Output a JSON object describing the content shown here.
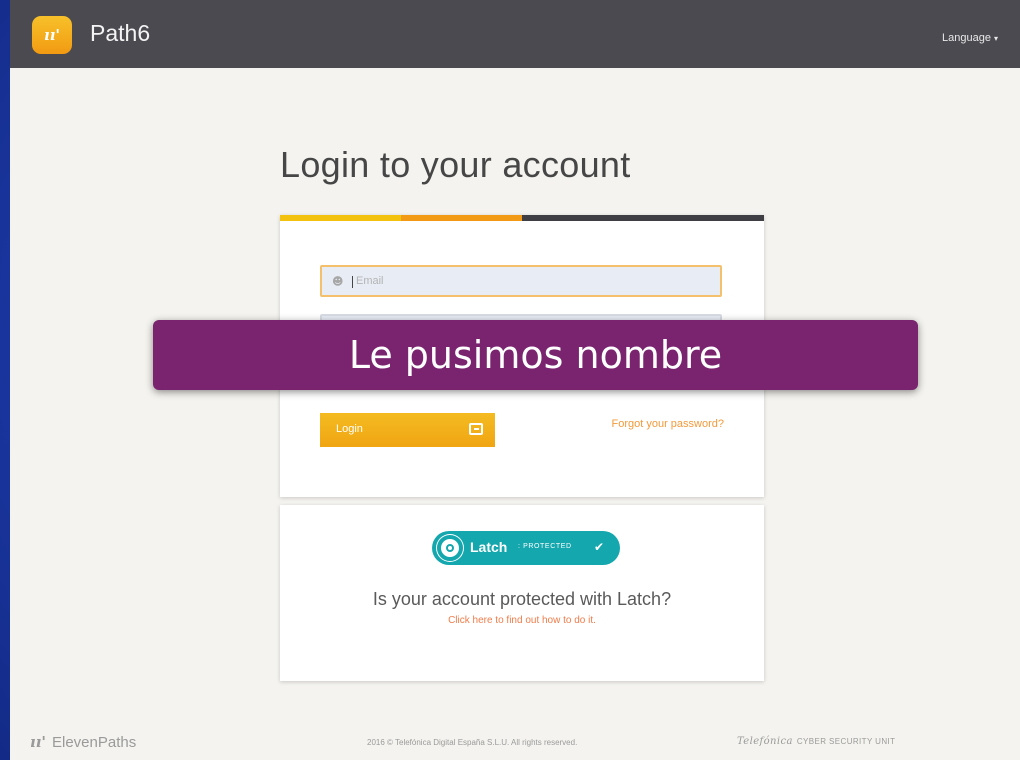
{
  "topbar": {
    "logo_mark": "ıı'",
    "brand": "Path6",
    "language_label": "Language",
    "language_caret": "▾"
  },
  "page_title": "Login to your account",
  "login_form": {
    "email_placeholder": "Email",
    "login_label": "Login",
    "forgot_password": "Forgot your password?"
  },
  "latch": {
    "name": "Latch",
    "status": ": PROTECTED",
    "check": "✔",
    "question": "Is your account protected with Latch?",
    "link": "Click here to find out how to do it."
  },
  "footer": {
    "left_mark": "ıı'",
    "left": "ElevenPaths",
    "copyright": "2016 © Telefónica Digital España S.L.U. All rights reserved.",
    "right_logo": "Telefónica",
    "right": "CYBER SECURITY UNIT"
  },
  "overlay": {
    "caption": "Le pusimos nombre"
  },
  "colors": {
    "slide_background": "#1c3aa8",
    "topbar": "#4b4a50",
    "accent_yellow": "#f2c20e",
    "accent_orange": "#f29a16",
    "latch_teal": "#14a7ae",
    "overlay_purple": "#7a246f"
  }
}
